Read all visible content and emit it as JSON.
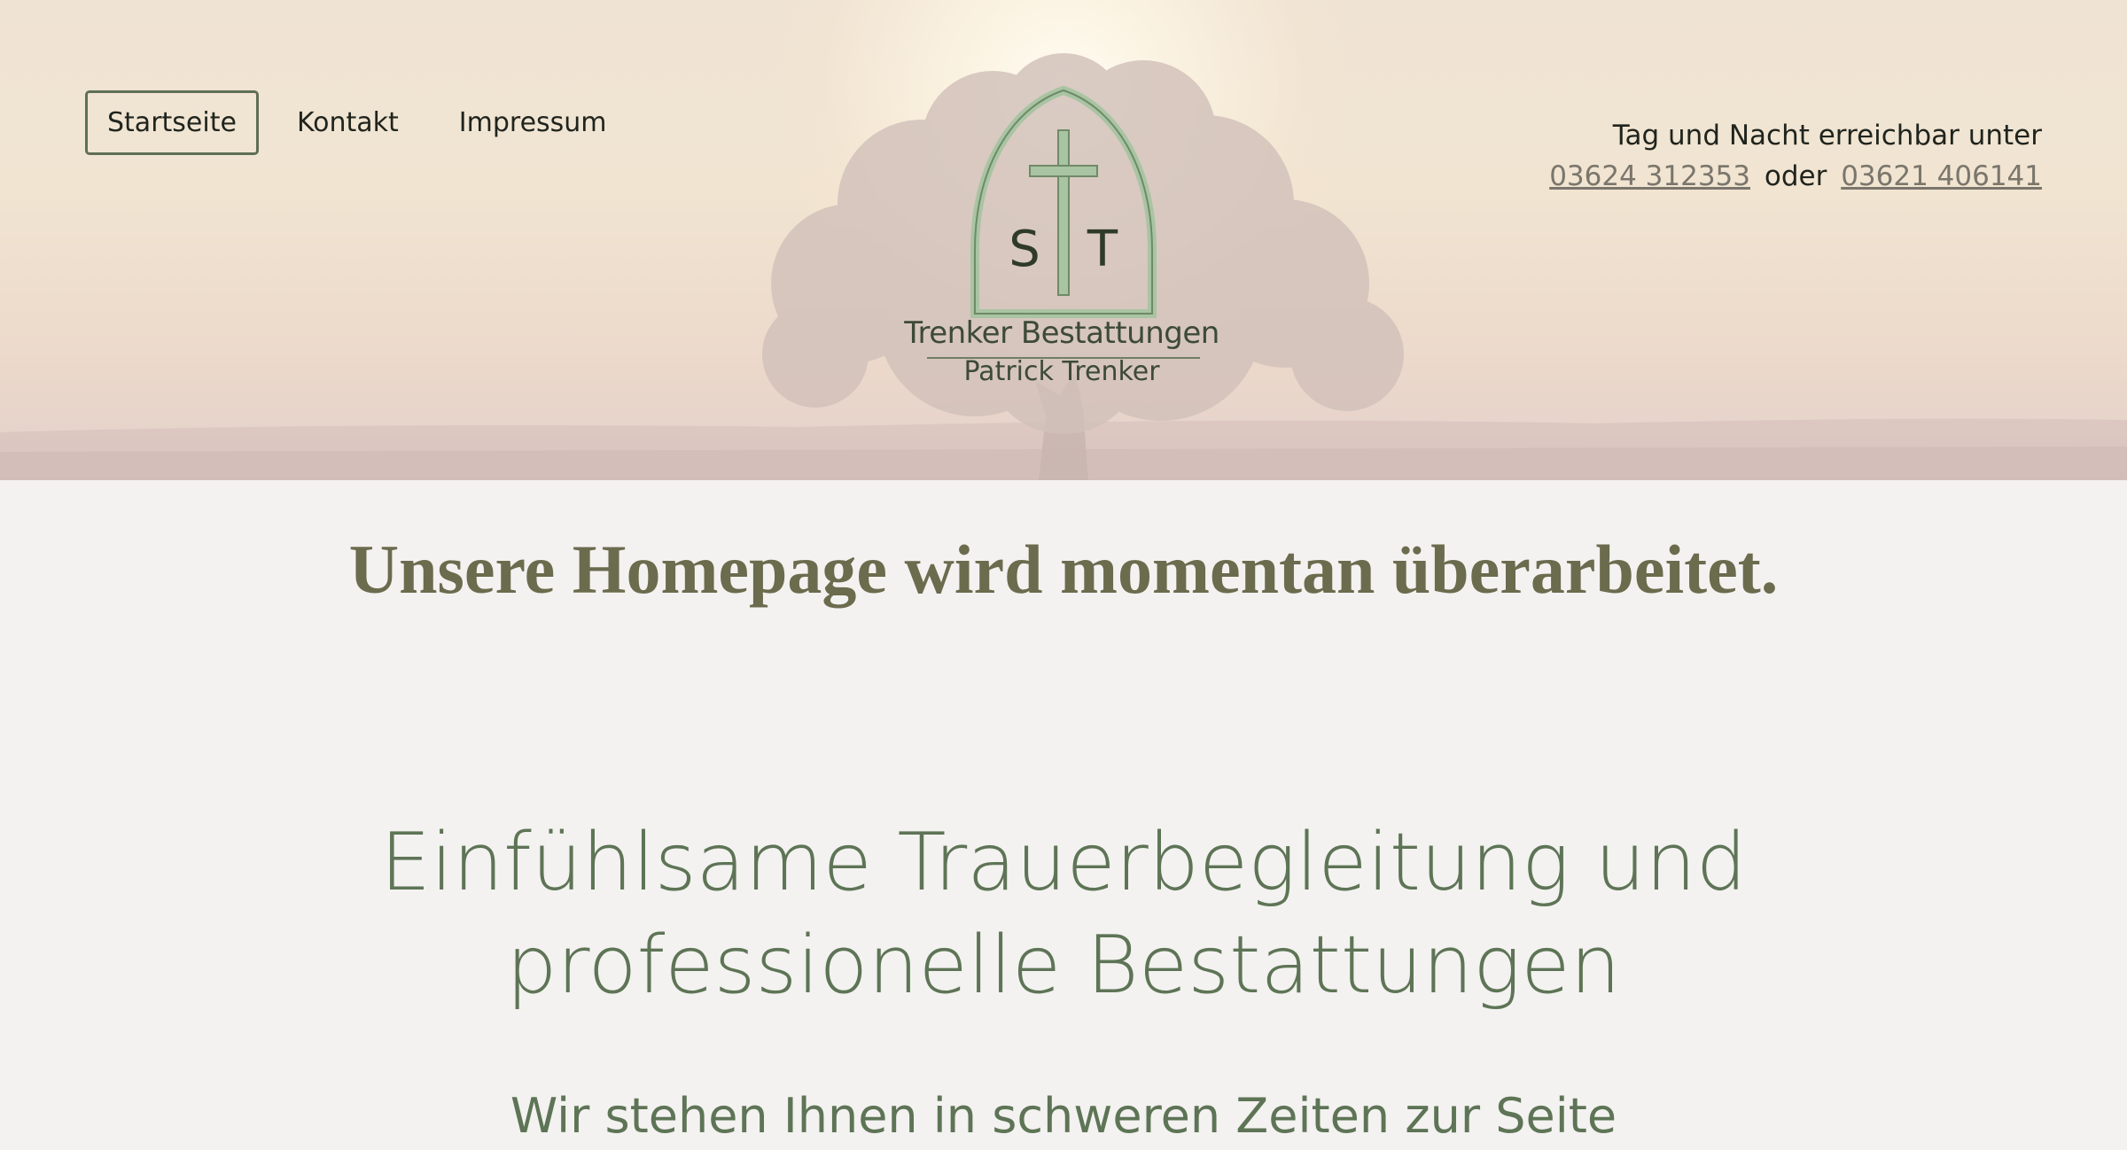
{
  "nav": {
    "items": [
      {
        "label": "Startseite",
        "active": true
      },
      {
        "label": "Kontakt",
        "active": false
      },
      {
        "label": "Impressum",
        "active": false
      }
    ]
  },
  "contact": {
    "intro": "Tag und Nacht erreichbar unter",
    "phone_1": "03624 312353",
    "separator": "oder",
    "phone_2": "03621 406141"
  },
  "logo": {
    "monogram_left": "S",
    "monogram_right": "T",
    "title": "Trenker Bestattungen",
    "subtitle": "Patrick Trenker"
  },
  "notice": "Unsere Homepage wird momentan überarbeitet.",
  "headline": {
    "line_1": "Einfühlsame Trauerbegleitung und",
    "line_2": "professionelle Bestattungen"
  },
  "subline": "Wir stehen Ihnen in schweren Zeiten zur Seite",
  "colors": {
    "accent_green": "#5e7456",
    "notice_olive": "#6b6b4e",
    "logo_green": "#a9c4a3"
  }
}
